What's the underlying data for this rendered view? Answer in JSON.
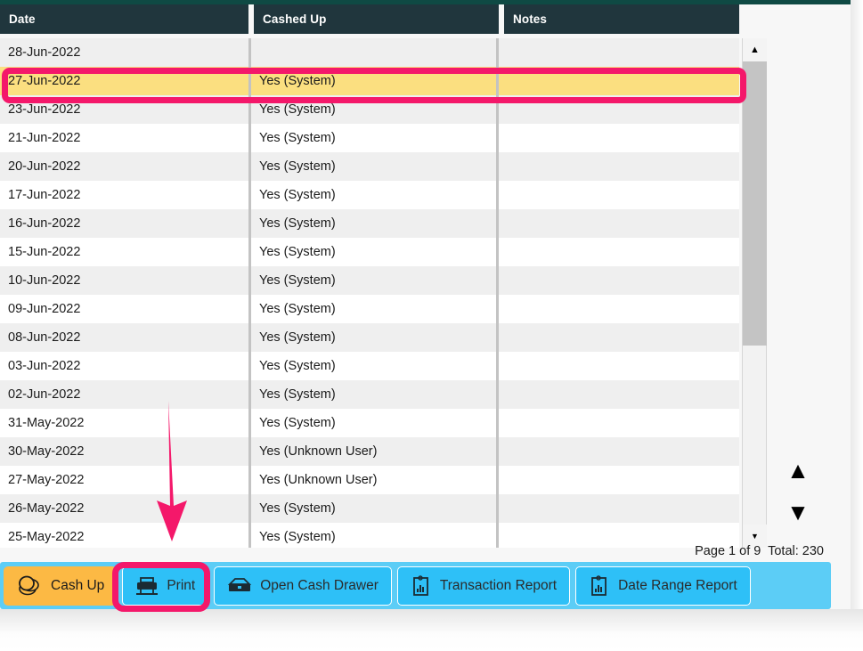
{
  "colors": {
    "header_bg": "#20363d",
    "top_strip": "#0f4a44",
    "toolbar_bg": "#5ccdf6",
    "button_bg": "#2ec0f7",
    "cashup_bg": "#fcb944",
    "selected_row": "#fbdf80",
    "annotation": "#f4186a",
    "row_alt": "#efefef"
  },
  "grid": {
    "columns": [
      "Date",
      "Cashed Up",
      "Notes"
    ],
    "rows": [
      {
        "date": "28-Jun-2022",
        "cashed_up": "",
        "notes": "",
        "selected": false
      },
      {
        "date": "27-Jun-2022",
        "cashed_up": "Yes (System)",
        "notes": "",
        "selected": true
      },
      {
        "date": "23-Jun-2022",
        "cashed_up": "Yes (System)",
        "notes": "",
        "selected": false
      },
      {
        "date": "21-Jun-2022",
        "cashed_up": "Yes (System)",
        "notes": "",
        "selected": false
      },
      {
        "date": "20-Jun-2022",
        "cashed_up": "Yes (System)",
        "notes": "",
        "selected": false
      },
      {
        "date": "17-Jun-2022",
        "cashed_up": "Yes (System)",
        "notes": "",
        "selected": false
      },
      {
        "date": "16-Jun-2022",
        "cashed_up": "Yes (System)",
        "notes": "",
        "selected": false
      },
      {
        "date": "15-Jun-2022",
        "cashed_up": "Yes (System)",
        "notes": "",
        "selected": false
      },
      {
        "date": "10-Jun-2022",
        "cashed_up": "Yes (System)",
        "notes": "",
        "selected": false
      },
      {
        "date": "09-Jun-2022",
        "cashed_up": "Yes (System)",
        "notes": "",
        "selected": false
      },
      {
        "date": "08-Jun-2022",
        "cashed_up": "Yes (System)",
        "notes": "",
        "selected": false
      },
      {
        "date": "03-Jun-2022",
        "cashed_up": "Yes (System)",
        "notes": "",
        "selected": false
      },
      {
        "date": "02-Jun-2022",
        "cashed_up": "Yes (System)",
        "notes": "",
        "selected": false
      },
      {
        "date": "31-May-2022",
        "cashed_up": "Yes (System)",
        "notes": "",
        "selected": false
      },
      {
        "date": "30-May-2022",
        "cashed_up": "Yes (Unknown User)",
        "notes": "",
        "selected": false
      },
      {
        "date": "27-May-2022",
        "cashed_up": "Yes (Unknown User)",
        "notes": "",
        "selected": false
      },
      {
        "date": "26-May-2022",
        "cashed_up": "Yes (System)",
        "notes": "",
        "selected": false
      },
      {
        "date": "25-May-2022",
        "cashed_up": "Yes (System)",
        "notes": "",
        "selected": false
      }
    ]
  },
  "scrollbar": {
    "up_arrow": "▲",
    "down_arrow": "▼"
  },
  "spinner": {
    "up_arrow": "▲",
    "down_arrow": "▼"
  },
  "status": {
    "page_info": "Page 1 of 9  Total: 230"
  },
  "toolbar": {
    "buttons": [
      {
        "label": "Cash Up",
        "icon": "coins-icon"
      },
      {
        "label": "Print",
        "icon": "printer-icon"
      },
      {
        "label": "Open Cash Drawer",
        "icon": "cash-drawer-icon"
      },
      {
        "label": "Transaction Report",
        "icon": "report-chart-icon"
      },
      {
        "label": "Date Range Report",
        "icon": "report-chart-icon"
      }
    ]
  }
}
